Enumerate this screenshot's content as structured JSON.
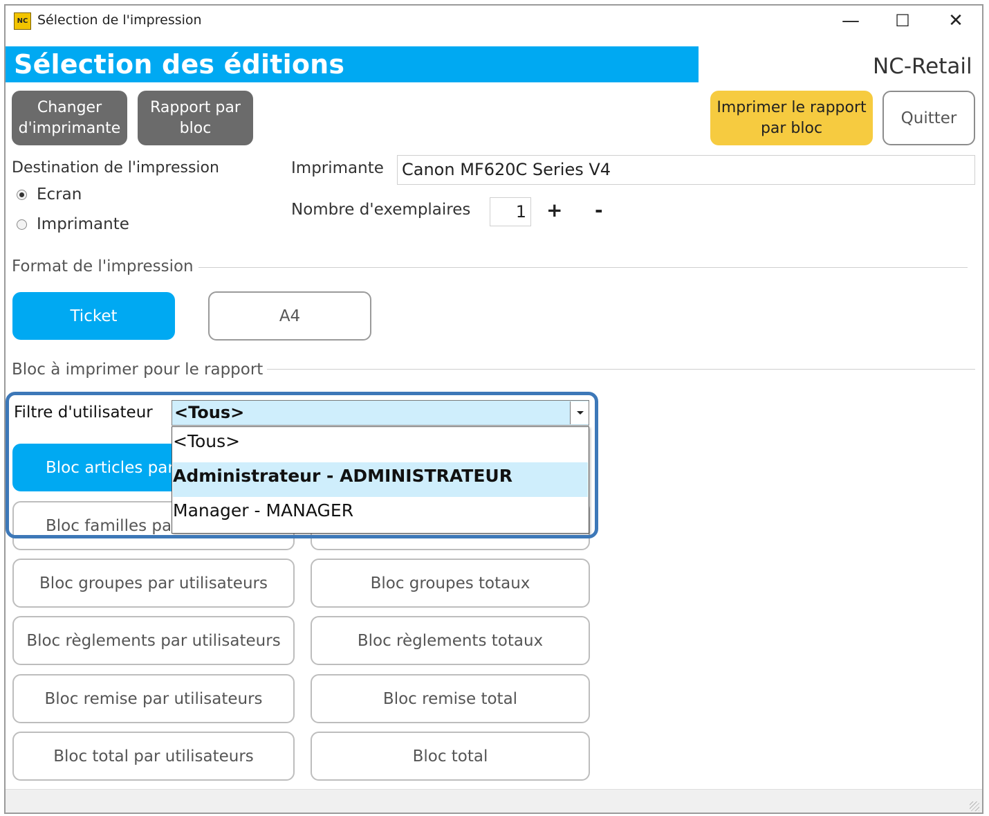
{
  "window": {
    "title": "Sélection de l'impression",
    "icon_text": "NC",
    "controls": {
      "minimize": "—",
      "maximize": "☐",
      "close": "✕"
    }
  },
  "header": {
    "title": "Sélection des éditions",
    "app_name": "NC-Retail"
  },
  "toolbar": {
    "change_printer": "Changer d'imprimante",
    "report_by_block": "Rapport par bloc",
    "print_report_by_block": "Imprimer le rapport par bloc",
    "quit": "Quitter"
  },
  "destination": {
    "label": "Destination de l'impression",
    "options": [
      {
        "label": "Ecran",
        "selected": true
      },
      {
        "label": "Imprimante",
        "selected": false
      }
    ]
  },
  "printer": {
    "label": "Imprimante",
    "value": "Canon MF620C Series V4",
    "copies_label": "Nombre d'exemplaires",
    "copies_value": "1",
    "plus": "+",
    "minus": "-"
  },
  "format": {
    "label": "Format de l'impression",
    "options": [
      "Ticket",
      "A4"
    ],
    "selected": "Ticket"
  },
  "block": {
    "label": "Bloc à imprimer pour le rapport",
    "user_filter_label": "Filtre d'utilisateur",
    "user_filter_value": "<Tous>",
    "dropdown_options": [
      "<Tous>",
      "Administrateur - ADMINISTRATEUR",
      "Manager - MANAGER"
    ],
    "dropdown_highlighted": "Administrateur - ADMINISTRATEUR",
    "buttons_left": [
      "Bloc articles par",
      "Bloc familles par",
      "Bloc groupes par utilisateurs",
      "Bloc règlements par utilisateurs",
      "Bloc remise par utilisateurs",
      "Bloc total par utilisateurs"
    ],
    "buttons_right": [
      "Bloc groupes totaux",
      "Bloc règlements totaux",
      "Bloc remise total",
      "Bloc total"
    ]
  },
  "colors": {
    "accent": "#00a9f2",
    "print_button": "#f6cb40",
    "dark_button": "#6b6b6b",
    "highlight_border": "#3d78b8",
    "selection": "#cfeefc"
  }
}
